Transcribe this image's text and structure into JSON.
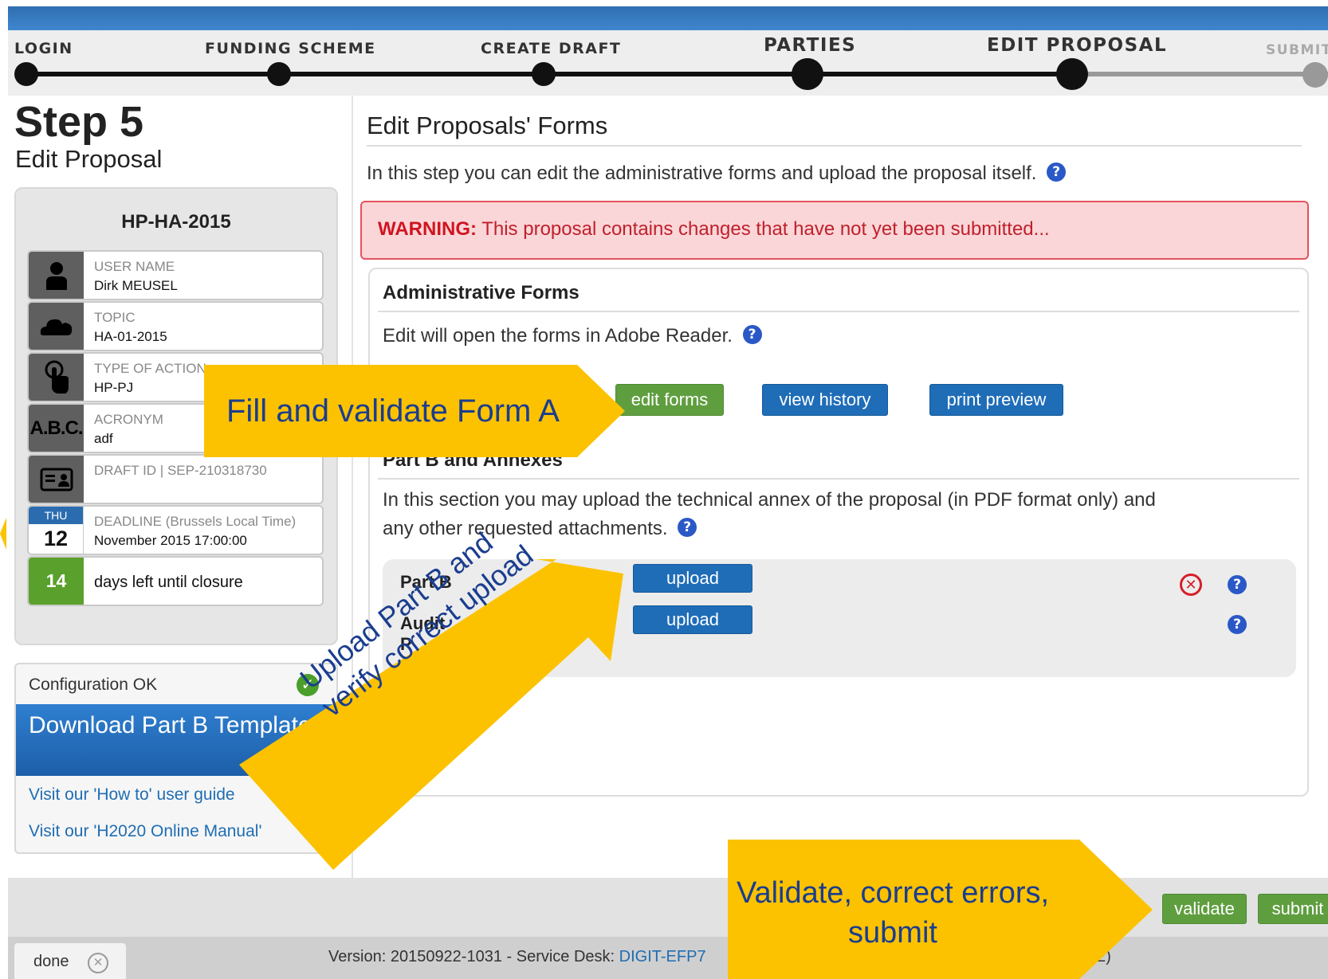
{
  "stepper": {
    "steps": [
      {
        "label": "LOGIN"
      },
      {
        "label": "FUNDING SCHEME"
      },
      {
        "label": "CREATE DRAFT"
      },
      {
        "label": "PARTIES"
      },
      {
        "label": "EDIT PROPOSAL"
      },
      {
        "label": "SUBMIT"
      }
    ]
  },
  "sidebar": {
    "step_title": "Step 5",
    "step_subtitle": "Edit Proposal",
    "call_id": "HP-HA-2015",
    "rows": [
      {
        "label": "USER NAME",
        "value": "Dirk MEUSEL",
        "icon": "user-icon"
      },
      {
        "label": "TOPIC",
        "value": "HA-01-2015",
        "icon": "cloud-icon"
      },
      {
        "label": "TYPE OF ACTION",
        "value": "HP-PJ",
        "icon": "touch-icon"
      },
      {
        "label": "ACRONYM",
        "value": "adf",
        "icon": "abc-icon",
        "icon_text": "A.B.C."
      },
      {
        "label": "DRAFT ID | SEP-210318730",
        "value": "",
        "icon": "id-card-icon"
      },
      {
        "label": "DEADLINE (Brussels Local Time)",
        "value": "November 2015 17:00:00",
        "icon": "calendar-icon",
        "cal_day": "THU",
        "cal_num": "12"
      },
      {
        "label": "",
        "value": "days left until closure",
        "icon": "days-left-badge",
        "badge": "14"
      }
    ],
    "config_status": "Configuration OK",
    "download_templates": "Download Part B Templates",
    "links": [
      "Visit our 'How to' user guide",
      "Visit our 'H2020 Online Manual'"
    ]
  },
  "main": {
    "title": "Edit Proposals' Forms",
    "intro": "In this step you can edit the administrative forms and upload the proposal itself.",
    "help_glyph": "?",
    "warning_label": "WARNING:",
    "warning_text": "This proposal contains changes that have not yet been submitted...",
    "admin": {
      "heading": "Administrative Forms",
      "text": "Edit will open the forms in Adobe Reader.",
      "buttons": {
        "edit": "edit forms",
        "history": "view history",
        "print": "print preview"
      }
    },
    "partb": {
      "heading": "Part B and Annexes",
      "text_line1": "In this section you may upload the technical annex of the proposal (in PDF format only) and",
      "text_line2": "any other requested attachments.",
      "rows": [
        {
          "label": "Part B",
          "button": "upload"
        },
        {
          "label": "Audit",
          "label2": "P",
          "button": "upload"
        }
      ]
    }
  },
  "bottom": {
    "validate": "validate",
    "submit": "submit"
  },
  "footer": {
    "tab": "done",
    "version_prefix": "Version: 20150922-1031 - Service Desk: ",
    "version_link": "DIGIT-EFP7",
    "version_tail": "22)"
  },
  "callouts": {
    "form_a": "Fill and validate Form A",
    "upload_line1": "Upload Part B and",
    "upload_line2": "verify correct upload",
    "validate_line1": "Validate, correct errors,",
    "validate_line2": "submit"
  },
  "colors": {
    "accent_blue": "#1f6db7",
    "button_green": "#5f9e3f",
    "warning_red": "#d01420",
    "callout_yellow": "#fcc200",
    "callout_text": "#1a3d8f"
  }
}
